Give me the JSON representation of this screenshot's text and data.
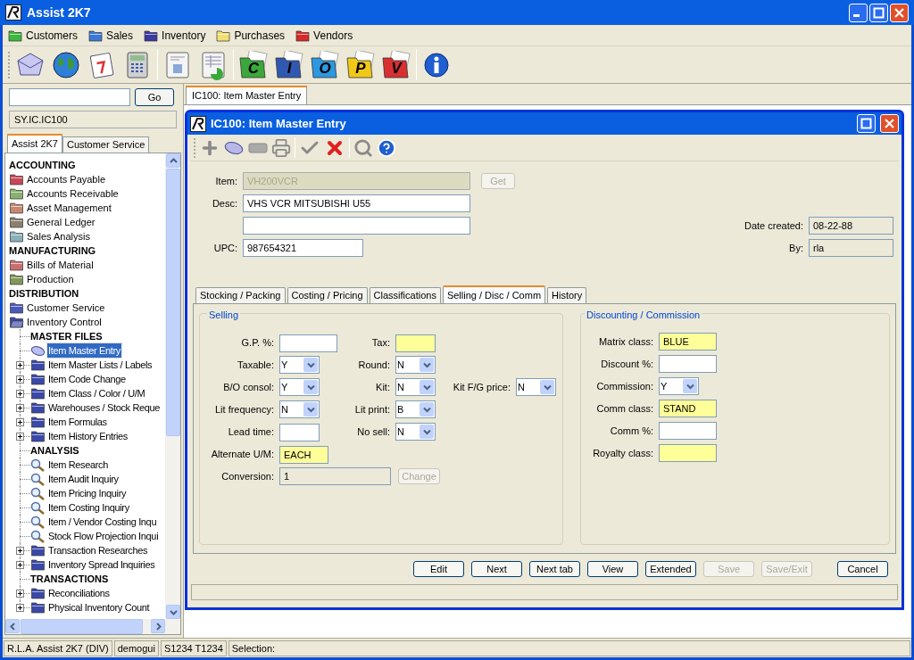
{
  "window": {
    "title": "Assist 2K7"
  },
  "menu": [
    {
      "label": "Customers",
      "color": "#3cb83c"
    },
    {
      "label": "Sales",
      "color": "#3a78d8"
    },
    {
      "label": "Inventory",
      "color": "#3a3aa0"
    },
    {
      "label": "Purchases",
      "color": "#f0e070"
    },
    {
      "label": "Vendors",
      "color": "#d82828"
    }
  ],
  "letter_folders": [
    {
      "letter": "C",
      "color": "#3aa83a"
    },
    {
      "letter": "I",
      "color": "#3058b0"
    },
    {
      "letter": "O",
      "color": "#2c98e0"
    },
    {
      "letter": "P",
      "color": "#f0c818"
    },
    {
      "letter": "V",
      "color": "#d83030"
    }
  ],
  "sidebar": {
    "go_button": "Go",
    "path": "SY.IC.IC100",
    "tabs": [
      {
        "label": "Assist 2K7",
        "selected": true
      },
      {
        "label": "Customer Service",
        "selected": false
      }
    ],
    "tree": [
      {
        "label": "ACCOUNTING",
        "children": [
          {
            "label": "Accounts Payable",
            "color": "#c84858"
          },
          {
            "label": "Accounts Receivable",
            "color": "#88b070"
          },
          {
            "label": "Asset Management",
            "color": "#c88870"
          },
          {
            "label": "General Ledger",
            "color": "#8a8070"
          },
          {
            "label": "Sales Analysis",
            "color": "#88b0b8"
          }
        ]
      },
      {
        "label": "MANUFACTURING",
        "children": [
          {
            "label": "Bills of Material",
            "color": "#c87070"
          },
          {
            "label": "Production",
            "color": "#80985a"
          }
        ]
      },
      {
        "label": "DISTRIBUTION",
        "children": [
          {
            "label": "Customer Service",
            "color": "#4a58b8",
            "expanded": false
          },
          {
            "label": "Inventory Control",
            "color": "#3a48a8",
            "expanded": true,
            "children": [
              {
                "kind": "section",
                "label": "MASTER FILES"
              },
              {
                "kind": "entry",
                "label": "Item Master Entry",
                "selected": true
              },
              {
                "kind": "folder",
                "label": "Item Master Lists / Labels",
                "selected": false,
                "expanded": false
              },
              {
                "kind": "folder",
                "label": "Item Code Change",
                "selected": false,
                "expanded": false
              },
              {
                "kind": "folder",
                "label": "Item Class / Color / U/M",
                "selected": false,
                "expanded": false
              },
              {
                "kind": "folder",
                "label": "Warehouses / Stock Reque",
                "selected": false,
                "expanded": false
              },
              {
                "kind": "folder",
                "label": "Item Formulas",
                "selected": false,
                "expanded": false
              },
              {
                "kind": "folder",
                "label": "Item History Entries",
                "selected": false,
                "expanded": false
              },
              {
                "kind": "section",
                "label": "ANALYSIS"
              },
              {
                "kind": "inquiry",
                "label": "Item Research",
                "selected": false
              },
              {
                "kind": "inquiry",
                "label": "Item Audit Inquiry",
                "selected": false
              },
              {
                "kind": "inquiry",
                "label": "Item Pricing Inquiry",
                "selected": false
              },
              {
                "kind": "inquiry",
                "label": "Item Costing Inquiry",
                "selected": false
              },
              {
                "kind": "inquiry",
                "label": "Item / Vendor Costing Inqu",
                "selected": false
              },
              {
                "kind": "inquiry",
                "label": "Stock Flow Projection Inqui",
                "selected": false
              },
              {
                "kind": "folder",
                "label": "Transaction Researches",
                "selected": false,
                "expanded": false
              },
              {
                "kind": "folder",
                "label": "Inventory Spread Inquiries",
                "selected": false,
                "expanded": false
              },
              {
                "kind": "section",
                "label": "TRANSACTIONS"
              },
              {
                "kind": "folder",
                "label": "Reconciliations",
                "selected": false,
                "expanded": false
              },
              {
                "kind": "folder",
                "label": "Physical Inventory Count",
                "selected": false,
                "expanded": false
              }
            ]
          }
        ]
      }
    ]
  },
  "document_tabs": [
    {
      "label": "IC100: Item Master Entry",
      "selected": true
    }
  ],
  "dialog": {
    "title": "IC100: Item Master Entry",
    "header": {
      "item": {
        "label": "Item:",
        "value": "VH200VCR",
        "disabled": true
      },
      "get_button": {
        "label": "Get",
        "disabled": true
      },
      "desc": {
        "label": "Desc:",
        "value": "VHS VCR MITSUBISHI U55"
      },
      "upc": {
        "label": "UPC:",
        "value": "987654321"
      },
      "date_created": {
        "label": "Date created:",
        "value": "08-22-88"
      },
      "by": {
        "label": "By:",
        "value": "rla"
      }
    },
    "tabs": [
      {
        "label": "Stocking / Packing",
        "selected": false
      },
      {
        "label": "Costing / Pricing",
        "selected": false
      },
      {
        "label": "Classifications",
        "selected": false
      },
      {
        "label": "Selling / Disc / Comm",
        "selected": true
      },
      {
        "label": "History",
        "selected": false
      }
    ],
    "selling": {
      "title": "Selling",
      "rows": [
        [
          {
            "label": "G.P. %:",
            "kind": "text",
            "required": false
          },
          {
            "label": "Tax:",
            "kind": "text",
            "required": true
          }
        ],
        [
          {
            "label": "Taxable:",
            "kind": "select",
            "value": "Y",
            "required": false
          },
          {
            "label": "Round:",
            "kind": "select",
            "value": "N",
            "required": false
          }
        ],
        [
          {
            "label": "B/O consol:",
            "kind": "select",
            "value": "Y",
            "required": false
          },
          {
            "label": "Kit:",
            "kind": "select",
            "value": "N",
            "required": false
          },
          {
            "label": "Kit F/G price:",
            "kind": "select",
            "value": "N",
            "required": false
          }
        ],
        [
          {
            "label": "Lit frequency:",
            "kind": "select",
            "value": "N",
            "required": false
          },
          {
            "label": "Lit print:",
            "kind": "select",
            "value": "B",
            "required": false
          }
        ],
        [
          {
            "label": "Lead time:",
            "kind": "text",
            "required": false
          },
          {
            "label": "No sell:",
            "kind": "select",
            "value": "N",
            "required": false
          }
        ],
        [
          {
            "label": "Alternate U/M:",
            "kind": "text",
            "value": "EACH",
            "required": true
          }
        ],
        [
          {
            "label": "Conversion:",
            "kind": "readonly",
            "value": "1",
            "required": false,
            "button": {
              "label": "Change",
              "disabled": true
            }
          }
        ]
      ]
    },
    "discounting": {
      "title": "Discounting / Commission",
      "fields": [
        {
          "label": "Matrix class:",
          "kind": "text",
          "value": "BLUE",
          "required": true
        },
        {
          "label": "Discount %:",
          "kind": "text",
          "required": false
        },
        {
          "label": "Commission:",
          "kind": "select",
          "value": "Y",
          "required": false
        },
        {
          "label": "Comm class:",
          "kind": "text",
          "value": "STAND",
          "required": true
        },
        {
          "label": "Comm %:",
          "kind": "text",
          "required": false
        },
        {
          "label": "Royalty class:",
          "kind": "text",
          "required": true
        }
      ]
    },
    "buttons": [
      {
        "label": "Edit",
        "disabled": false
      },
      {
        "label": "Next",
        "disabled": false
      },
      {
        "label": "Next tab",
        "disabled": false
      },
      {
        "label": "View",
        "disabled": false
      },
      {
        "label": "Extended",
        "disabled": false
      },
      {
        "label": "Save",
        "disabled": true
      },
      {
        "label": "Save/Exit",
        "disabled": true
      },
      {
        "label": "Cancel",
        "disabled": false
      }
    ]
  },
  "status_bar": [
    "R.L.A. Assist 2K7 (DIV)",
    "demogui",
    "S1234 T1234",
    "Selection:"
  ]
}
